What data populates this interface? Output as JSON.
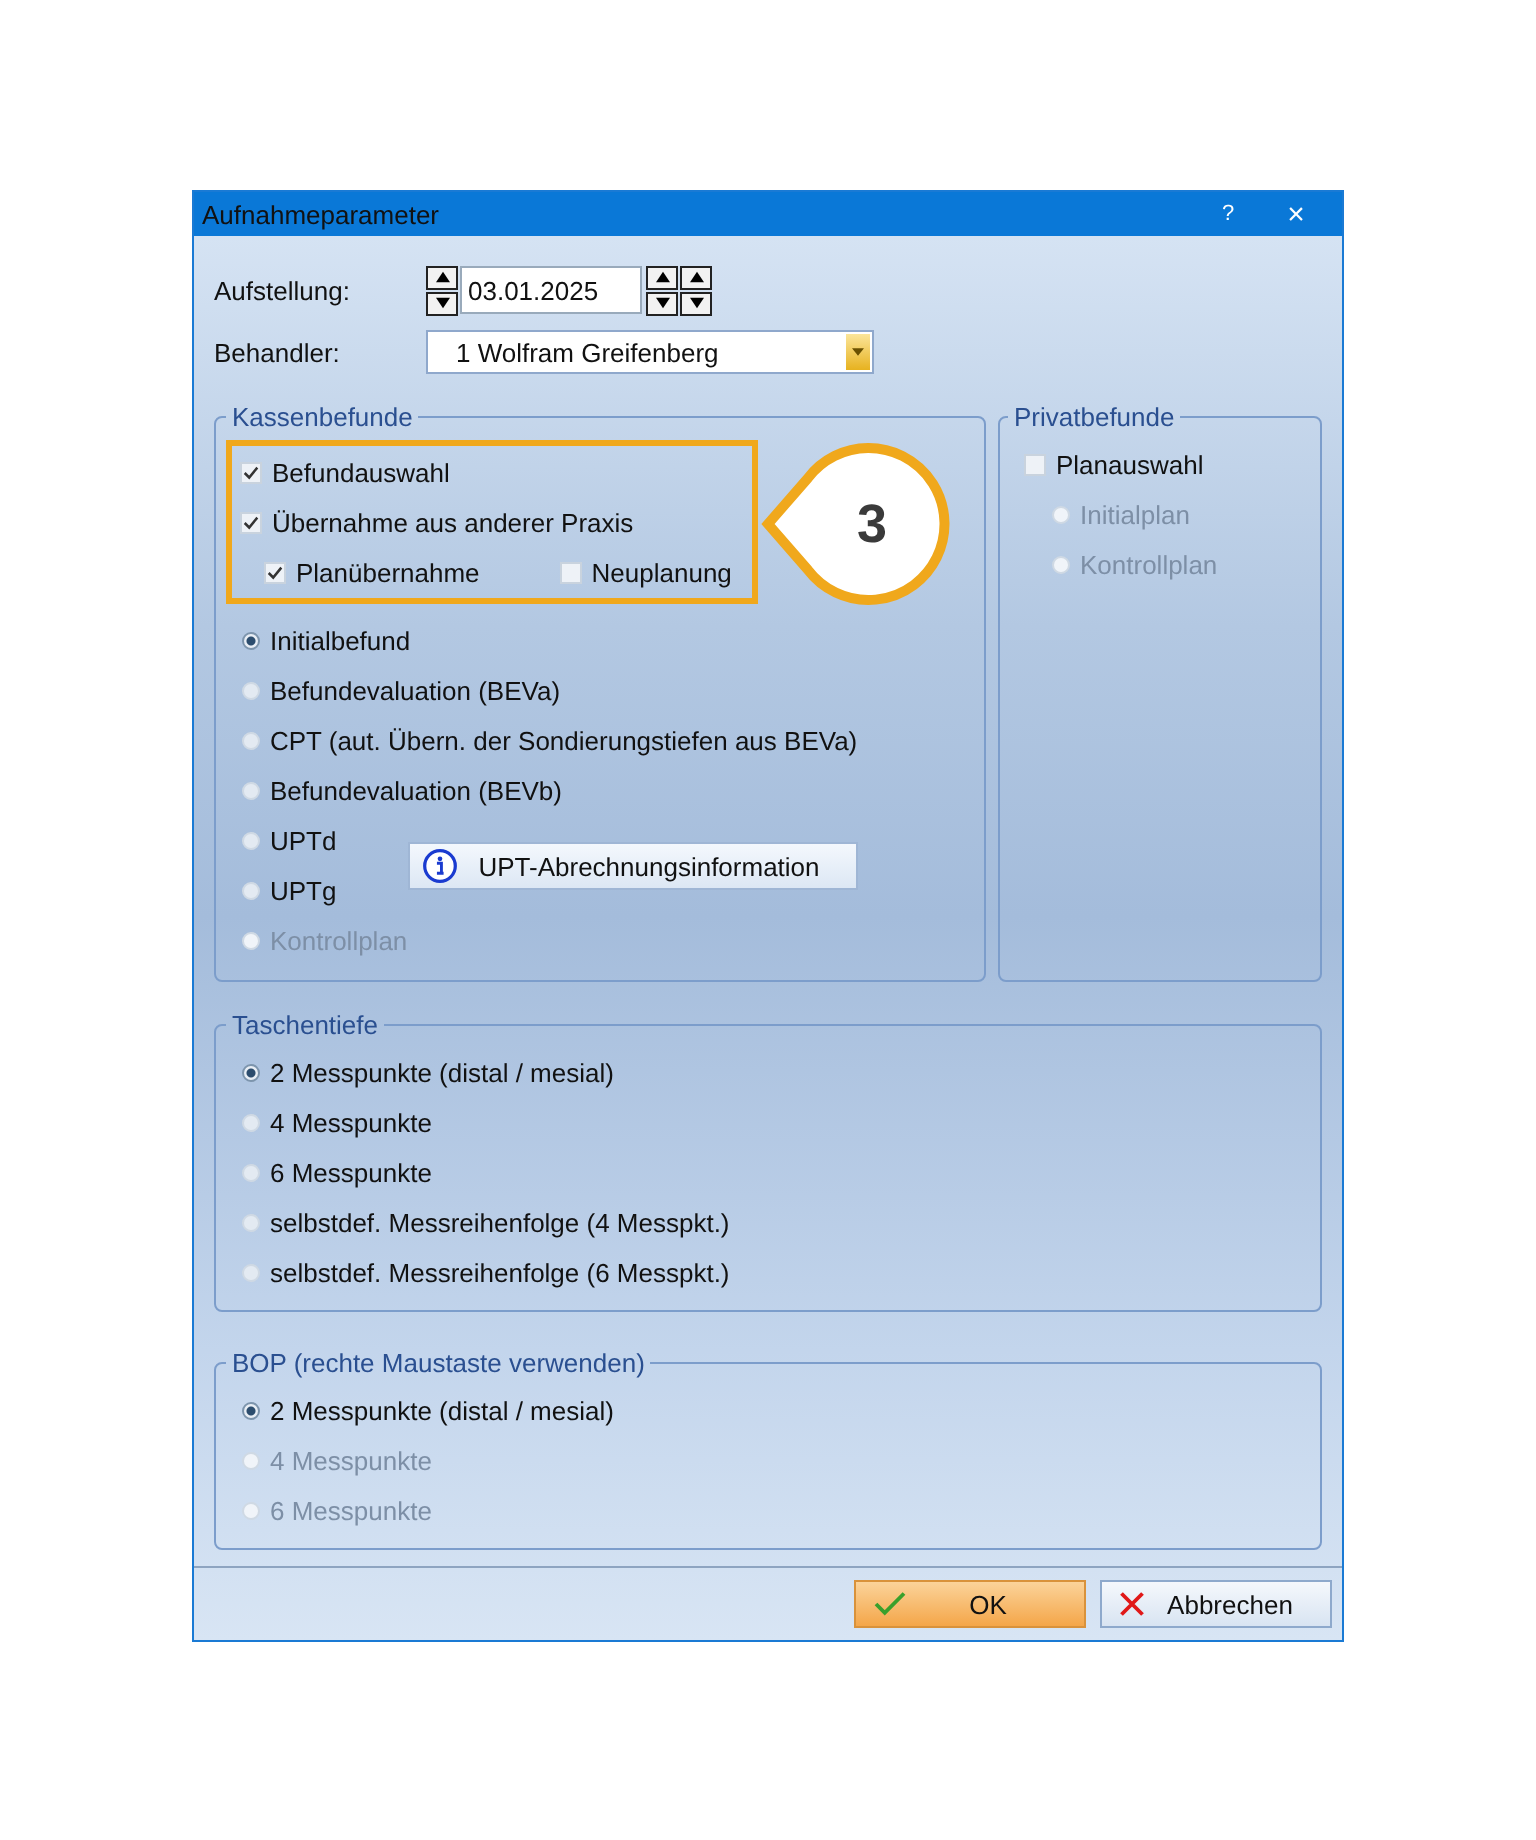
{
  "window": {
    "title": "Aufnahmeparameter",
    "help": "?",
    "close": "×"
  },
  "aufstellung": {
    "label": "Aufstellung:",
    "value": "03.01.2025"
  },
  "behandler": {
    "label": "Behandler:",
    "value": "1 Wolfram Greifenberg"
  },
  "kassenbefunde": {
    "title": "Kassenbefunde",
    "checkboxes": [
      {
        "label": "Befundauswahl",
        "checked": true
      },
      {
        "label": "Übernahme aus anderer Praxis",
        "checked": true
      }
    ],
    "sub_checkboxes": [
      {
        "label": "Planübernahme",
        "checked": true
      },
      {
        "label": "Neuplanung",
        "checked": false
      }
    ],
    "callout": "3",
    "radios": [
      {
        "label": "Initialbefund",
        "selected": true,
        "disabled": false
      },
      {
        "label": "Befundevaluation (BEVa)",
        "selected": false,
        "disabled": false
      },
      {
        "label": "CPT (aut. Übern. der Sondierungstiefen aus BEVa)",
        "selected": false,
        "disabled": false
      },
      {
        "label": "Befundevaluation (BEVb)",
        "selected": false,
        "disabled": false
      }
    ],
    "upt_radios": [
      {
        "label": "UPTd",
        "selected": false,
        "disabled": false
      },
      {
        "label": "UPTg",
        "selected": false,
        "disabled": false
      }
    ],
    "info_button": "UPT-Abrechnungsinformation",
    "radios_after": [
      {
        "label": "Kontrollplan",
        "selected": false,
        "disabled": true
      }
    ]
  },
  "privatbefunde": {
    "title": "Privatbefunde",
    "checkbox": {
      "label": "Planauswahl",
      "checked": false
    },
    "radios": [
      {
        "label": "Initialplan",
        "selected": false,
        "disabled": true
      },
      {
        "label": "Kontrollplan",
        "selected": false,
        "disabled": true
      }
    ]
  },
  "taschentiefe": {
    "title": "Taschentiefe",
    "radios": [
      {
        "label": "2 Messpunkte (distal / mesial)",
        "selected": true,
        "disabled": false
      },
      {
        "label": "4 Messpunkte",
        "selected": false,
        "disabled": false
      },
      {
        "label": "6 Messpunkte",
        "selected": false,
        "disabled": false
      },
      {
        "label": "selbstdef. Messreihenfolge (4 Messpkt.)",
        "selected": false,
        "disabled": false
      },
      {
        "label": "selbstdef. Messreihenfolge (6 Messpkt.)",
        "selected": false,
        "disabled": false
      }
    ]
  },
  "bop": {
    "title": "BOP (rechte Maustaste verwenden)",
    "radios": [
      {
        "label": "2 Messpunkte (distal / mesial)",
        "selected": true,
        "disabled": false
      },
      {
        "label": "4 Messpunkte",
        "selected": false,
        "disabled": true
      },
      {
        "label": "6 Messpunkte",
        "selected": false,
        "disabled": true
      }
    ]
  },
  "buttons": [
    {
      "label": "OK",
      "kind": "ok"
    },
    {
      "label": "Abbrechen",
      "kind": "cancel"
    }
  ]
}
